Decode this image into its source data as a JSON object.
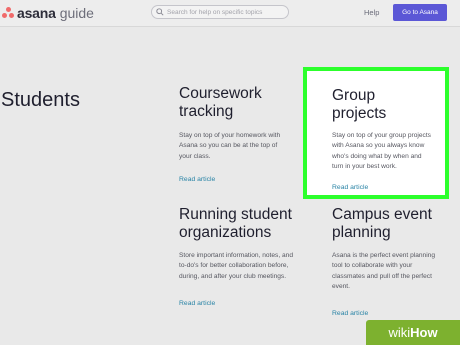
{
  "header": {
    "logo_brand": "asana",
    "logo_suffix": "guide",
    "search_placeholder": "Search for help on specific topics",
    "help_label": "Help",
    "goto_label": "Go to Asana"
  },
  "page": {
    "section_title": "Students"
  },
  "cards": [
    {
      "title": "Coursework tracking",
      "description": "Stay on top of your homework with Asana so you can be at the top of your class.",
      "link": "Read article"
    },
    {
      "title": "Group projects",
      "description": "Stay on top of your group projects with Asana so you always know who's doing what by when and turn in your best work.",
      "link": "Read article"
    },
    {
      "title": "Running student organizations",
      "description": "Store important information, notes, and to-do's for better collaboration before, during, and after your club meetings.",
      "link": "Read article"
    },
    {
      "title": "Campus event planning",
      "description": "Asana is the perfect event planning tool to collaborate with your classmates and pull off the perfect event.",
      "link": "Read article"
    }
  ],
  "watermark": {
    "wiki": "wiki",
    "how": "How"
  },
  "colors": {
    "accent_button": "#5b57d6",
    "link": "#2a84a6",
    "highlight_border": "#2cff2c",
    "logo_dots": "#f06a6a",
    "watermark_bg": "#7db12f"
  },
  "icons": {
    "logo": "asana-logo-icon",
    "search": "search-icon"
  }
}
